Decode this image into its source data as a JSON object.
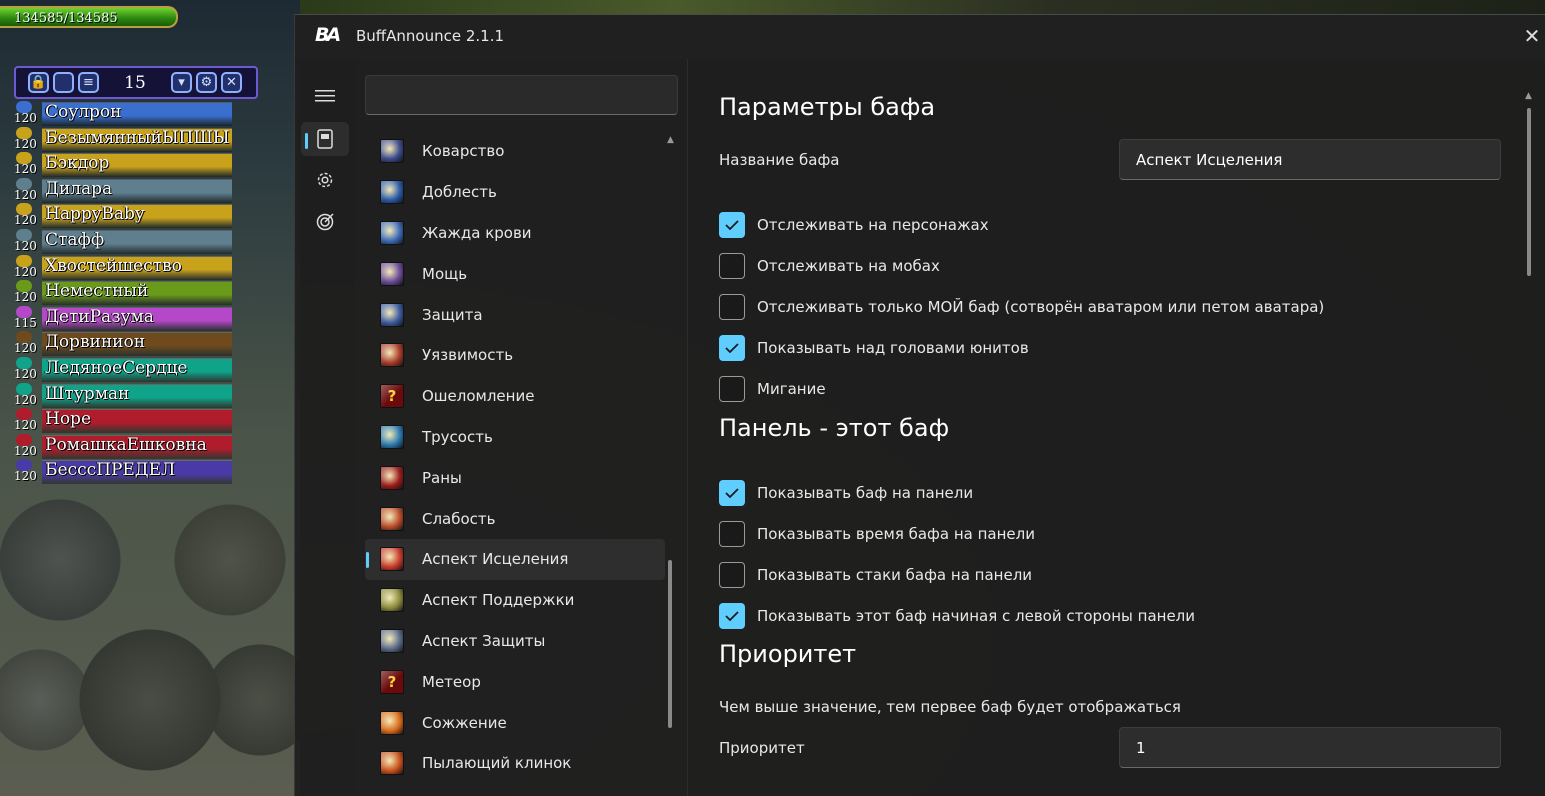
{
  "game": {
    "hp_text": "134585/134585",
    "group_count": "15",
    "toolbar_icons": [
      "lock-icon",
      "square-icon",
      "list-icon",
      "dropdown-icon",
      "wrench-icon",
      "close-icon"
    ],
    "raid": [
      {
        "level": "120",
        "name": "Соулрон",
        "color": "#3a6fd0"
      },
      {
        "level": "120",
        "name": "БезымянныйЫПШЫ",
        "color": "#c9a21c"
      },
      {
        "level": "120",
        "name": "Бэкдор",
        "color": "#c9a21c"
      },
      {
        "level": "120",
        "name": "Дилара",
        "color": "#5f7f8f"
      },
      {
        "level": "120",
        "name": "HappyBaby",
        "color": "#c9a21c"
      },
      {
        "level": "120",
        "name": "Стафф",
        "color": "#5f7f8f"
      },
      {
        "level": "120",
        "name": "Хвостейшество",
        "color": "#c9a21c"
      },
      {
        "level": "120",
        "name": "Неместный",
        "color": "#6a9a1a"
      },
      {
        "level": "115",
        "name": "ДетиРазума",
        "color": "#b548c8"
      },
      {
        "level": "120",
        "name": "Дорвинион",
        "color": "#6e4a1c"
      },
      {
        "level": "120",
        "name": "ЛедяноеСердце",
        "color": "#0fa38a"
      },
      {
        "level": "120",
        "name": "Штурман",
        "color": "#0fa38a"
      },
      {
        "level": "120",
        "name": "Hope",
        "color": "#b01c2c"
      },
      {
        "level": "120",
        "name": "РомашкаЕшковна",
        "color": "#b01c2c"
      },
      {
        "level": "120",
        "name": "БесссПРЕДЕЛ",
        "color": "#4a3aa8"
      }
    ]
  },
  "window": {
    "logo": "BA",
    "title": "BuffAnnounce 2.1.1",
    "close_glyph": "✕"
  },
  "nav": [
    {
      "name": "buffs-icon",
      "active": true
    },
    {
      "name": "settings-icon",
      "active": false
    },
    {
      "name": "target-icon",
      "active": false
    }
  ],
  "search": {
    "value": "",
    "placeholder": ""
  },
  "buffs": [
    {
      "label": "Коварство",
      "icon_color": "#3a4a8a"
    },
    {
      "label": "Доблесть",
      "icon_color": "#2a5aa8"
    },
    {
      "label": "Жажда крови",
      "icon_color": "#3a6ab8"
    },
    {
      "label": "Мощь",
      "icon_color": "#6a4a9a"
    },
    {
      "label": "Защита",
      "icon_color": "#3a5aa0"
    },
    {
      "label": "Уязвимость",
      "icon_color": "#a83a2a"
    },
    {
      "label": "Ошеломление",
      "icon_color": "#6a0a0a",
      "question": true
    },
    {
      "label": "Трусость",
      "icon_color": "#2a7ab0"
    },
    {
      "label": "Раны",
      "icon_color": "#9a1a1a"
    },
    {
      "label": "Слабость",
      "icon_color": "#b84a2a"
    },
    {
      "label": "Аспект Исцеления",
      "icon_color": "#c83a2a",
      "selected": true
    },
    {
      "label": "Аспект Поддержки",
      "icon_color": "#8a8a3a"
    },
    {
      "label": "Аспект Защиты",
      "icon_color": "#5a6a8a"
    },
    {
      "label": "Метеор",
      "icon_color": "#6a0a0a",
      "question": true
    },
    {
      "label": "Сожжение",
      "icon_color": "#d86a1a"
    },
    {
      "label": "Пылающий клинок",
      "icon_color": "#c8501a"
    }
  ],
  "detail": {
    "section1_title": "Параметры бафа",
    "name_label": "Название бафа",
    "name_value": "Аспект Исцеления",
    "checkboxes1": [
      {
        "label": "Отслеживать на персонажах",
        "checked": true
      },
      {
        "label": "Отслеживать на мобах",
        "checked": false
      },
      {
        "label": "Отслеживать только МОЙ баф (сотворён аватаром или петом аватара)",
        "checked": false
      },
      {
        "label": "Показывать над головами юнитов",
        "checked": true
      },
      {
        "label": "Мигание",
        "checked": false
      }
    ],
    "section2_title": "Панель - этот баф",
    "checkboxes2": [
      {
        "label": "Показывать баф на панели",
        "checked": true
      },
      {
        "label": "Показывать время бафа на панели",
        "checked": false
      },
      {
        "label": "Показывать стаки бафа на панели",
        "checked": false
      },
      {
        "label": "Показывать этот баф начиная с левой стороны панели",
        "checked": true
      }
    ],
    "section3_title": "Приоритет",
    "priority_desc": "Чем выше значение, тем первее баф будет отображаться",
    "priority_label": "Приоритет",
    "priority_value": "1"
  },
  "colors": {
    "accent": "#60cdff"
  }
}
